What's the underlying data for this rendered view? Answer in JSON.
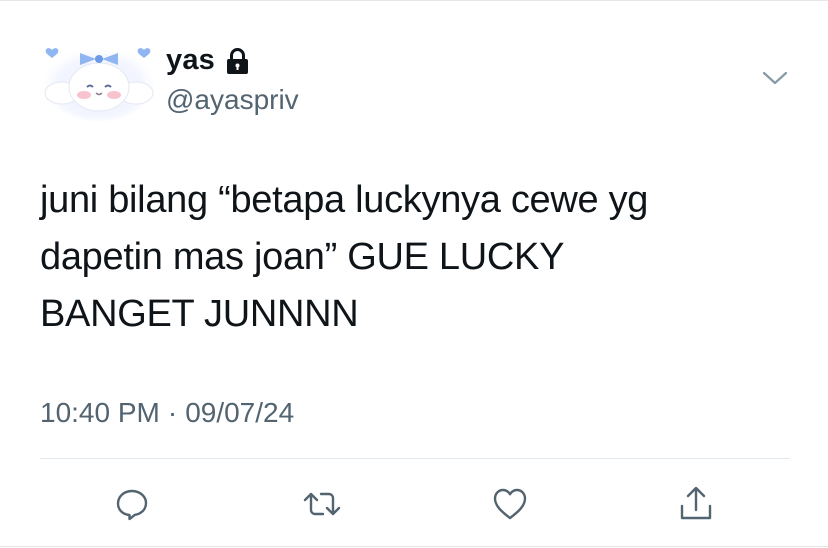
{
  "tweet": {
    "display_name": "yas",
    "handle": "@ayaspriv",
    "is_protected": true,
    "text": "juni bilang “betapa luckynya cewe yg\ndapetin mas joan” GUE LUCKY\nBANGET JUNNNN",
    "time": "10:40 PM",
    "separator": "·",
    "date": "09/07/24"
  },
  "icons": {
    "protected": "lock-icon",
    "menu": "chevron-down-icon",
    "reply": "reply-icon",
    "retweet": "retweet-icon",
    "like": "heart-icon",
    "share": "share-icon"
  },
  "colors": {
    "text_primary": "#0f1419",
    "text_secondary": "#536471",
    "icon_gray": "#536471",
    "avatar_bow": "#8fb6f0"
  }
}
